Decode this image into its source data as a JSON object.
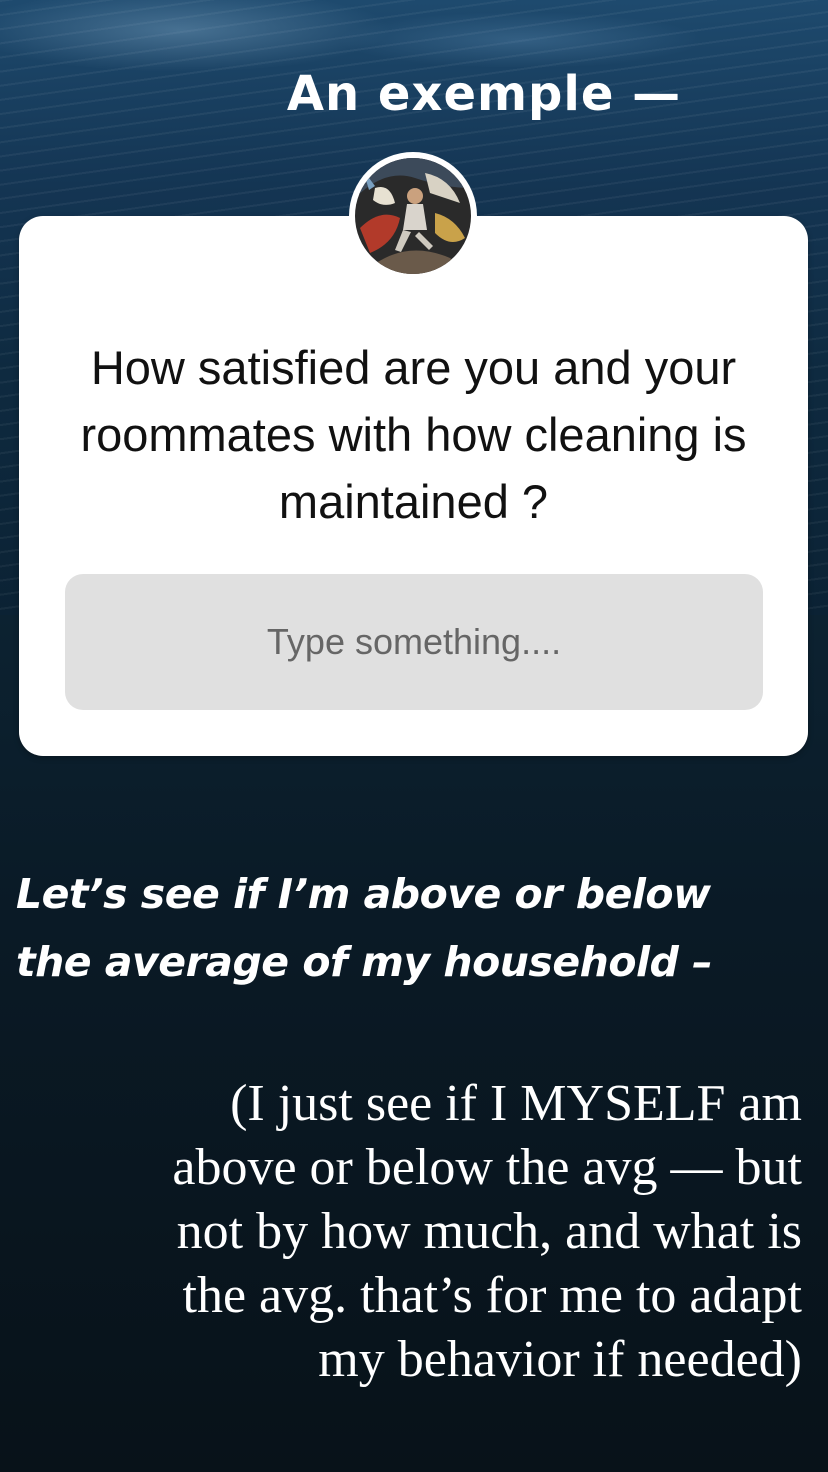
{
  "story": {
    "title": "An exemple —",
    "question": "How satisfied are you and your roommates with how cleaning is maintained ?",
    "answer_placeholder": "Type something....",
    "caption_line1": "Let’s see if I’m above or below",
    "caption_line2": "the average of my household –",
    "note_lines": [
      "(I just see if I MYSELF am",
      "above or below the avg — but",
      "not by how much, and what is",
      "the avg. that’s for me to adapt",
      "my behavior if needed)"
    ]
  }
}
